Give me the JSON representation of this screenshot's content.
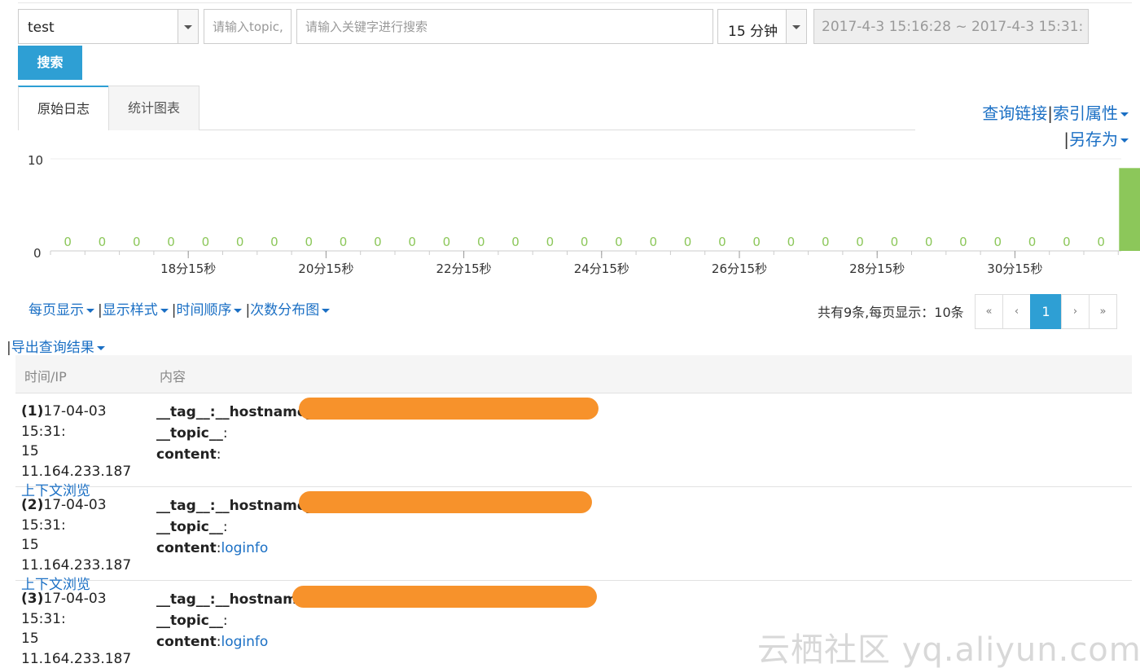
{
  "search": {
    "logstore_value": "test",
    "topic_placeholder": "请输入topic,",
    "keyword_placeholder": "请输入关键字进行搜索",
    "range_value": "15 分钟",
    "timespan_value": "2017-4-3 15:16:28 ~ 2017-4-3 15:31:",
    "search_label": "搜索"
  },
  "tabs": [
    {
      "label": "原始日志",
      "active": true
    },
    {
      "label": "统计图表",
      "active": false
    }
  ],
  "links": {
    "query_link": "查询链接",
    "index_props": "索引属性",
    "save_as": "另存为",
    "separator": "|"
  },
  "chart_data": {
    "type": "bar",
    "ylim": [
      0,
      10
    ],
    "yticks": [
      "10",
      "0"
    ],
    "values": [
      0,
      0,
      0,
      0,
      0,
      0,
      0,
      0,
      0,
      0,
      0,
      0,
      0,
      0,
      0,
      0,
      0,
      0,
      0,
      0,
      0,
      0,
      0,
      0,
      0,
      0,
      0,
      0,
      0,
      0,
      0,
      9
    ],
    "data_labels": [
      "0",
      "0",
      "0",
      "0",
      "0",
      "0",
      "0",
      "0",
      "0",
      "0",
      "0",
      "0",
      "0",
      "0",
      "0",
      "0",
      "0",
      "0",
      "0",
      "0",
      "0",
      "0",
      "0",
      "0",
      "0",
      "0",
      "0",
      "0",
      "0",
      "0",
      "0",
      ""
    ],
    "xtick_labels": [
      "18分15秒",
      "20分15秒",
      "22分15秒",
      "24分15秒",
      "26分15秒",
      "28分15秒",
      "30分15秒"
    ],
    "bar_color": "#8cc75a",
    "label_color": "#8cc75a"
  },
  "options": {
    "per_page": "每页显示",
    "display_style": "显示样式",
    "time_order": "时间顺序",
    "count_dist": "次数分布图",
    "export": "导出查询结果",
    "separator": "|"
  },
  "pagination": {
    "summary": "共有9条,每页显示：10条",
    "first": "«",
    "prev": "‹",
    "current": "1",
    "next": "›",
    "last": "»"
  },
  "table": {
    "headers": [
      "时间/IP",
      "内容"
    ],
    "context_label": "上下文浏览",
    "rows": [
      {
        "index": "(1)",
        "time_a": "17-04-03 15:31:",
        "time_b": "15",
        "ip": "11.164.233.187",
        "tag_key": "__tag__:__hostname__",
        "tag_value": "",
        "topic_key": "__topic__",
        "topic_value": "",
        "content_key": "content",
        "content_value": ""
      },
      {
        "index": "(2)",
        "time_a": "17-04-03 15:31:",
        "time_b": "15",
        "ip": "11.164.233.187",
        "tag_key": "__tag__:__hostname__",
        "tag_value": "",
        "topic_key": "__topic__",
        "topic_value": "",
        "content_key": "content",
        "content_value": "loginfo"
      },
      {
        "index": "(3)",
        "time_a": "17-04-03 15:31:",
        "time_b": "15",
        "ip": "11.164.233.187",
        "tag_key": "__tag__:__hostname__",
        "tag_value": "",
        "topic_key": "__topic__",
        "topic_value": "",
        "content_key": "content",
        "content_value": "loginfo"
      }
    ]
  },
  "watermark": "云栖社区 yq.aliyun.com",
  "colors": {
    "accent": "#2e9fd4",
    "link": "#1a6fc4",
    "redaction": "#f7922b"
  }
}
